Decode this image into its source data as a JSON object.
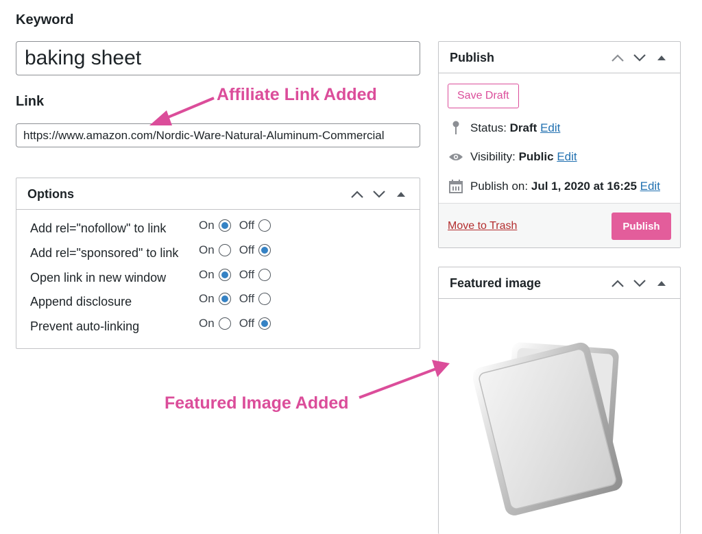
{
  "keyword": {
    "label": "Keyword",
    "value": "baking sheet"
  },
  "link": {
    "label": "Link",
    "value": "https://www.amazon.com/Nordic-Ware-Natural-Aluminum-Commercial"
  },
  "options": {
    "title": "Options",
    "on_label": "On",
    "off_label": "Off",
    "rows": [
      {
        "label": "Add rel=\"nofollow\" to link",
        "on": true
      },
      {
        "label": "Add rel=\"sponsored\" to link",
        "on": false
      },
      {
        "label": "Open link in new window",
        "on": true
      },
      {
        "label": "Append disclosure",
        "on": true
      },
      {
        "label": "Prevent auto-linking",
        "on": false
      }
    ]
  },
  "publish": {
    "title": "Publish",
    "save_draft": "Save Draft",
    "status_label": "Status:",
    "status_value": "Draft",
    "visibility_label": "Visibility:",
    "visibility_value": "Public",
    "publish_on_label": "Publish on:",
    "publish_on_value": "Jul 1, 2020 at 16:25",
    "edit": "Edit",
    "trash": "Move to Trash",
    "publish_button": "Publish"
  },
  "featured": {
    "title": "Featured image"
  },
  "annotations": {
    "affiliate": "Affiliate Link Added",
    "featured": "Featured Image Added"
  },
  "colors": {
    "accent_pink": "#db4d9a",
    "publish_button": "#e35d9b",
    "link_blue": "#2271b1",
    "radio_blue": "#3582c4",
    "trash_red": "#b32d2e"
  }
}
